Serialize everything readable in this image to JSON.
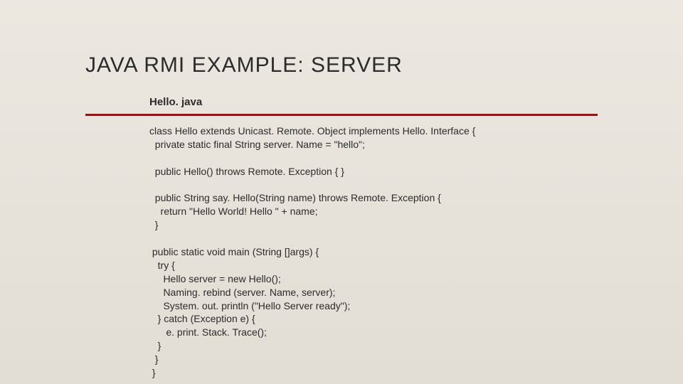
{
  "slide": {
    "title": "JAVA RMI EXAMPLE: SERVER",
    "filename": "Hello. java",
    "code": "class Hello extends Unicast. Remote. Object implements Hello. Interface {\n  private static final String server. Name = \"hello\";\n\n  public Hello() throws Remote. Exception { }\n\n  public String say. Hello(String name) throws Remote. Exception {\n    return \"Hello World! Hello \" + name;\n  }\n\n public static void main (String []args) {\n   try {\n     Hello server = new Hello();\n     Naming. rebind (server. Name, server);\n     System. out. println (\"Hello Server ready\");\n   } catch (Exception e) {\n      e. print. Stack. Trace();\n   }\n  }\n }"
  }
}
